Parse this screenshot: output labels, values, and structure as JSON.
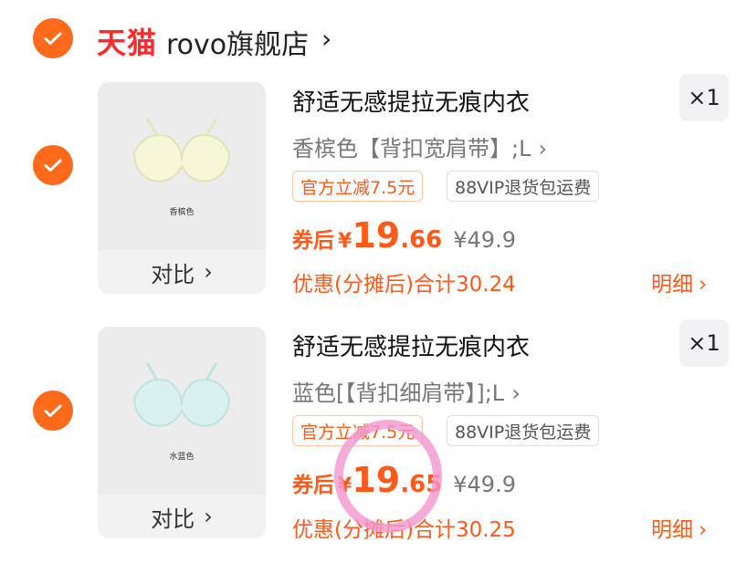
{
  "shop": {
    "logo_text": "天猫",
    "name": "rovo旗舰店",
    "arrow": "›"
  },
  "items": [
    {
      "title": "舒适无感提拉无痕内衣",
      "variant": "香槟色【背扣宽肩带】;L",
      "thumb_label": "香槟色",
      "thumb_color": "#f6f6d8",
      "quantity": "×1",
      "tag_discount": "官方立减7.5元",
      "tag_vip": "88VIP退货包运费",
      "price_prefix": "券后",
      "price_currency": "¥",
      "price_int": "19",
      "price_dec": ".66",
      "orig_price": "¥49.9",
      "summary": "优惠(分摊后)合计30.24",
      "detail": "明细",
      "compare": "对比"
    },
    {
      "title": "舒适无感提拉无痕内衣",
      "variant": "蓝色[【背扣细肩带】];L",
      "thumb_label": "水蓝色",
      "thumb_color": "#d9f1ee",
      "quantity": "×1",
      "tag_discount": "官方立减7.5元",
      "tag_vip": "88VIP退货包运费",
      "price_prefix": "券后",
      "price_currency": "¥",
      "price_int": "19",
      "price_dec": ".65",
      "orig_price": "¥49.9",
      "summary": "优惠(分摊后)合计30.25",
      "detail": "明细",
      "compare": "对比"
    }
  ],
  "colors": {
    "accent": "#ff5a1a",
    "check": "#ff6a1a",
    "tmall_red": "#ff2a2a",
    "highlight_circle": "#f396cd"
  },
  "icons": {
    "check": "checkmark-icon",
    "chevron": "chevron-right-icon"
  }
}
